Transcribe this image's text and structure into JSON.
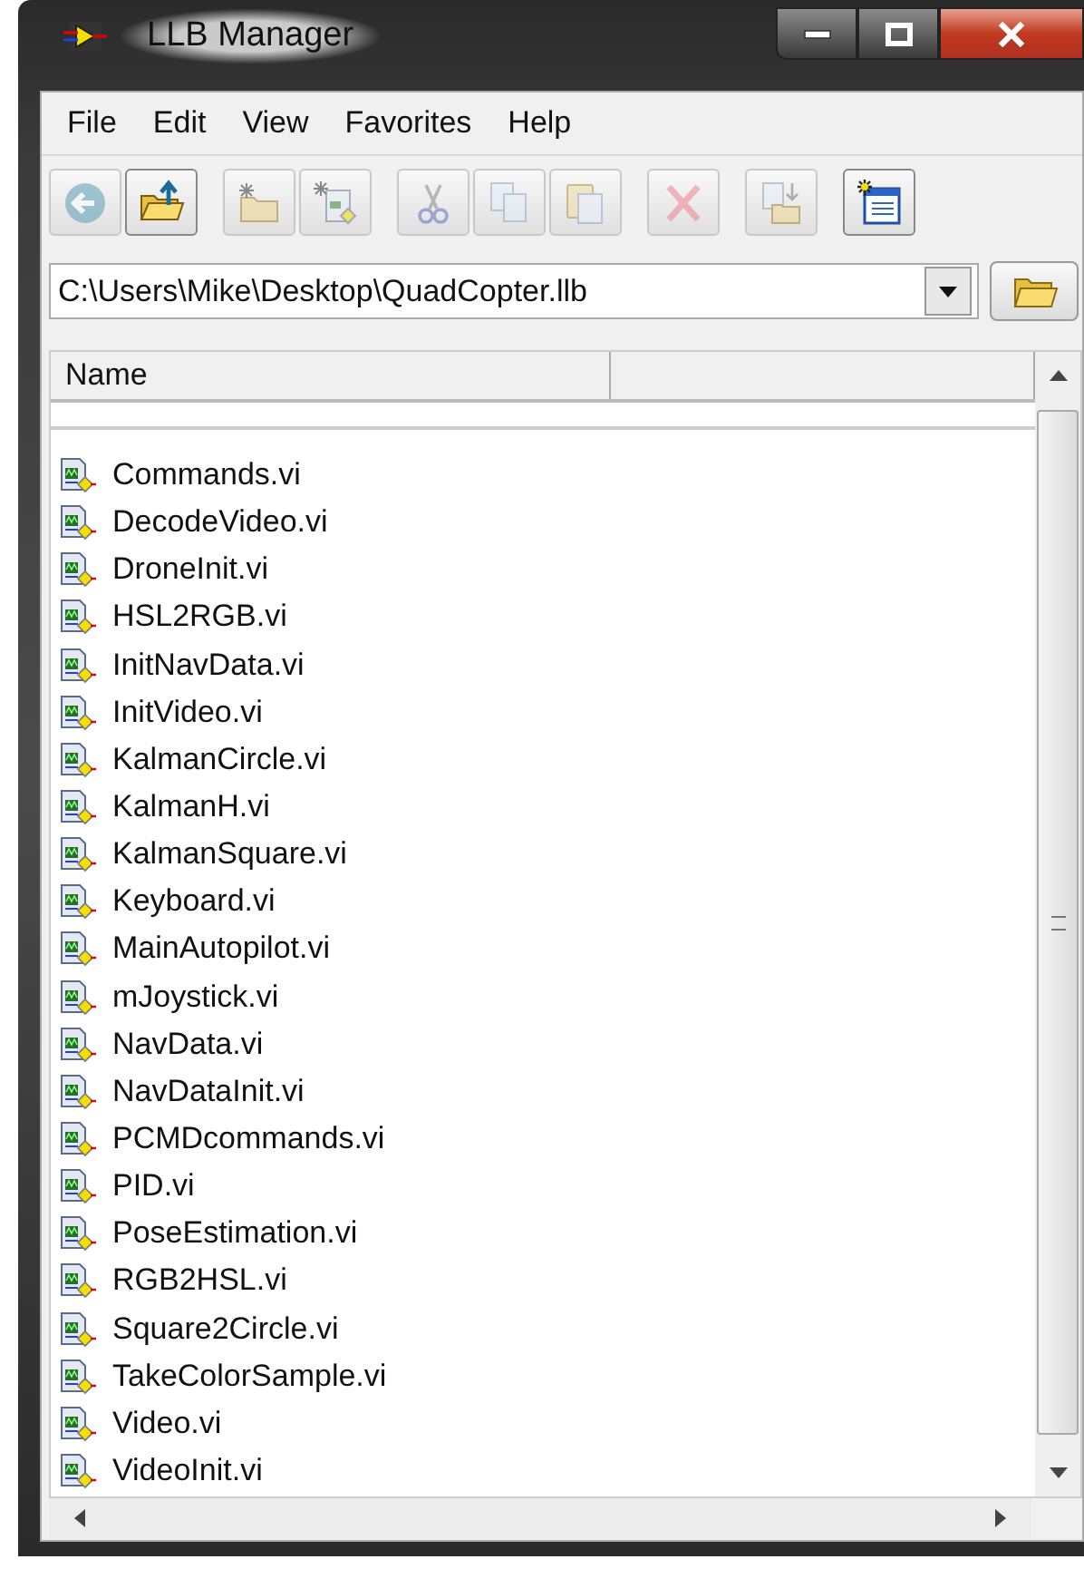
{
  "window": {
    "title": "LLB Manager"
  },
  "menu": [
    "File",
    "Edit",
    "View",
    "Favorites",
    "Help"
  ],
  "toolbar": [
    {
      "kind": "back",
      "disabled": true
    },
    {
      "kind": "up",
      "disabled": false
    },
    {
      "kind": "new-folder",
      "disabled": true
    },
    {
      "kind": "new-file",
      "disabled": true
    },
    {
      "kind": "cut",
      "disabled": true
    },
    {
      "kind": "copy",
      "disabled": true
    },
    {
      "kind": "paste",
      "disabled": true
    },
    {
      "kind": "delete",
      "disabled": true
    },
    {
      "kind": "move",
      "disabled": true
    },
    {
      "kind": "properties",
      "disabled": false
    }
  ],
  "path": {
    "value": "C:\\Users\\Mike\\Desktop\\QuadCopter.llb"
  },
  "list": {
    "columns": [
      "Name"
    ],
    "rows": [
      "Commands.vi",
      "DecodeVideo.vi",
      "DroneInit.vi",
      "HSL2RGB.vi",
      "InitNavData.vi",
      "InitVideo.vi",
      "KalmanCircle.vi",
      "KalmanH.vi",
      "KalmanSquare.vi",
      "Keyboard.vi",
      "MainAutopilot.vi",
      "mJoystick.vi",
      "NavData.vi",
      "NavDataInit.vi",
      "PCMDcommands.vi",
      "PID.vi",
      "PoseEstimation.vi",
      "RGB2HSL.vi",
      "Square2Circle.vi",
      "TakeColorSample.vi",
      "Video.vi",
      "VideoInit.vi"
    ]
  }
}
